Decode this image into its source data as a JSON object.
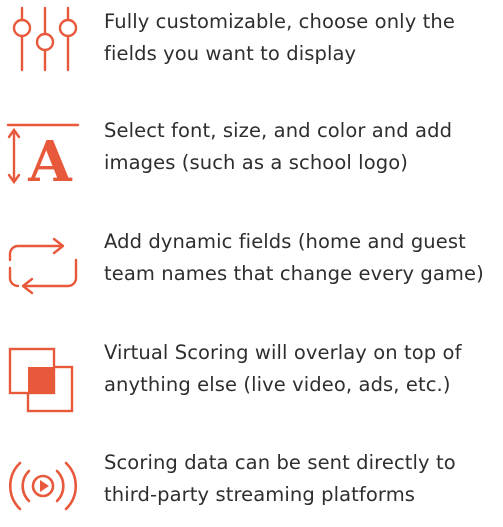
{
  "accent_color": "#e8583b",
  "features": [
    {
      "icon": "sliders-icon",
      "lines": [
        "Fully customizable, choose only the",
        "fields you want to display"
      ]
    },
    {
      "icon": "font-size-icon",
      "lines": [
        "Select font, size, and color and add",
        "images (such as a school logo)"
      ],
      "glyph": "A"
    },
    {
      "icon": "repeat-icon",
      "lines": [
        "Add dynamic fields (home and guest",
        "team names that change every game)"
      ]
    },
    {
      "icon": "overlay-icon",
      "lines": [
        "Virtual Scoring will overlay on top of",
        "anything else (live video, ads, etc.)"
      ]
    },
    {
      "icon": "broadcast-icon",
      "lines": [
        "Scoring data can be sent directly to",
        "third-party streaming platforms"
      ]
    }
  ]
}
